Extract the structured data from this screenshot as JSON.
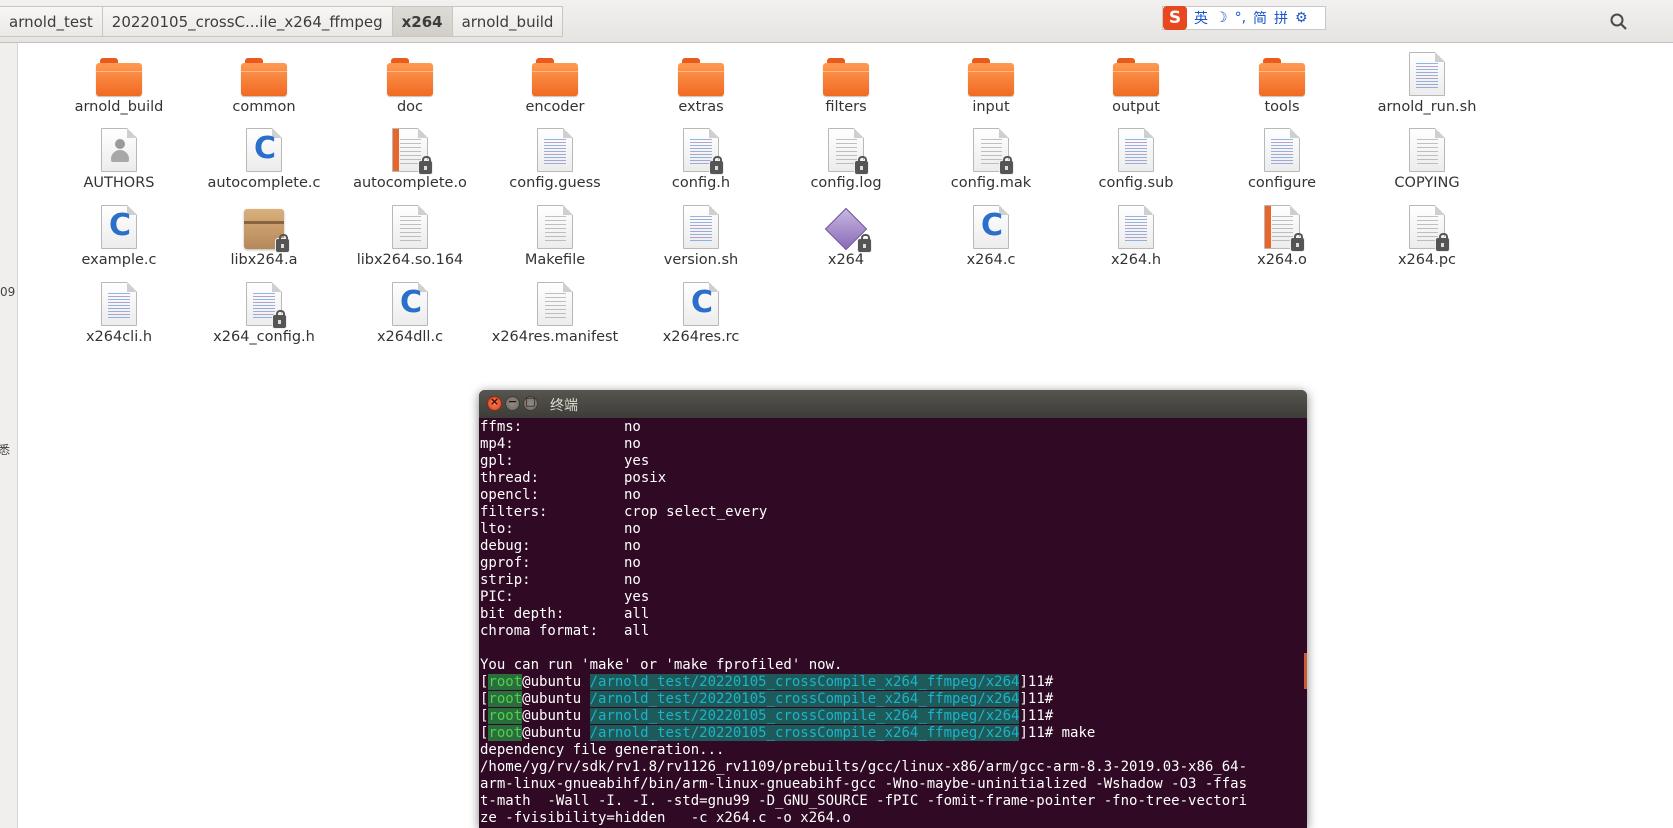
{
  "path_bar": {
    "crumbs": [
      "arnold_test",
      "20220105_crossC...ile_x264_ffmpeg",
      "x264",
      "arnold_build"
    ],
    "active_index": 2
  },
  "ime": {
    "logo": "S",
    "items": [
      "英",
      "☽",
      "°,",
      "简",
      "拼",
      "⚙"
    ]
  },
  "left_fragments": [
    "09",
    "悉"
  ],
  "files": [
    {
      "name": "arnold_build",
      "type": "folder"
    },
    {
      "name": "common",
      "type": "folder"
    },
    {
      "name": "doc",
      "type": "folder"
    },
    {
      "name": "encoder",
      "type": "folder"
    },
    {
      "name": "extras",
      "type": "folder"
    },
    {
      "name": "filters",
      "type": "folder"
    },
    {
      "name": "input",
      "type": "folder"
    },
    {
      "name": "output",
      "type": "folder"
    },
    {
      "name": "tools",
      "type": "folder"
    },
    {
      "name": "arnold_run.sh",
      "type": "script"
    },
    {
      "name": "AUTHORS",
      "type": "contact"
    },
    {
      "name": "autocomplete.c",
      "type": "c-source"
    },
    {
      "name": "autocomplete.o",
      "type": "object-locked"
    },
    {
      "name": "config.guess",
      "type": "script"
    },
    {
      "name": "config.h",
      "type": "header-locked"
    },
    {
      "name": "config.log",
      "type": "text-locked"
    },
    {
      "name": "config.mak",
      "type": "text-locked"
    },
    {
      "name": "config.sub",
      "type": "script"
    },
    {
      "name": "configure",
      "type": "script"
    },
    {
      "name": "COPYING",
      "type": "text"
    },
    {
      "name": "example.c",
      "type": "c-source"
    },
    {
      "name": "libx264.a",
      "type": "archive-locked"
    },
    {
      "name": "libx264.so.164",
      "type": "text"
    },
    {
      "name": "Makefile",
      "type": "text"
    },
    {
      "name": "version.sh",
      "type": "script"
    },
    {
      "name": "x264",
      "type": "executable-locked"
    },
    {
      "name": "x264.c",
      "type": "c-source"
    },
    {
      "name": "x264.h",
      "type": "header"
    },
    {
      "name": "x264.o",
      "type": "object-locked"
    },
    {
      "name": "x264.pc",
      "type": "text-locked"
    },
    {
      "name": "x264cli.h",
      "type": "header"
    },
    {
      "name": "x264_config.h",
      "type": "header-locked"
    },
    {
      "name": "x264dll.c",
      "type": "c-source"
    },
    {
      "name": "x264res.manifest",
      "type": "text"
    },
    {
      "name": "x264res.rc",
      "type": "c-source"
    }
  ],
  "terminal": {
    "title": "终端",
    "buttons": {
      "close": "×",
      "minimize": "−",
      "maximize": "□"
    },
    "config_lines": [
      {
        "k": "ffms:",
        "v": "no"
      },
      {
        "k": "mp4:",
        "v": "no"
      },
      {
        "k": "gpl:",
        "v": "yes"
      },
      {
        "k": "thread:",
        "v": "posix"
      },
      {
        "k": "opencl:",
        "v": "no"
      },
      {
        "k": "filters:",
        "v": "crop select_every"
      },
      {
        "k": "lto:",
        "v": "no"
      },
      {
        "k": "debug:",
        "v": "no"
      },
      {
        "k": "gprof:",
        "v": "no"
      },
      {
        "k": "strip:",
        "v": "no"
      },
      {
        "k": "PIC:",
        "v": "yes"
      },
      {
        "k": "bit depth:",
        "v": "all"
      },
      {
        "k": "chroma format:",
        "v": "all"
      }
    ],
    "hint": "You can run 'make' or 'make fprofiled' now.",
    "prompt": {
      "user": "root",
      "host": "@ubuntu ",
      "path": "/arnold_test/20220105_crossCompile_x264_ffmpeg/x264",
      "suffix": "]11#"
    },
    "commands": [
      "",
      "",
      "",
      " make"
    ],
    "output": [
      "dependency file generation...",
      "/home/yg/rv/sdk/rv1.8/rv1126_rv1109/prebuilts/gcc/linux-x86/arm/gcc-arm-8.3-2019.03-x86_64-",
      "arm-linux-gnueabihf/bin/arm-linux-gnueabihf-gcc -Wno-maybe-uninitialized -Wshadow -O3 -ffas",
      "t-math  -Wall -I. -I. -std=gnu99 -D_GNU_SOURCE -fPIC -fomit-frame-pointer -fno-tree-vectori",
      "ze -fvisibility=hidden   -c x264.c -o x264.o"
    ]
  }
}
